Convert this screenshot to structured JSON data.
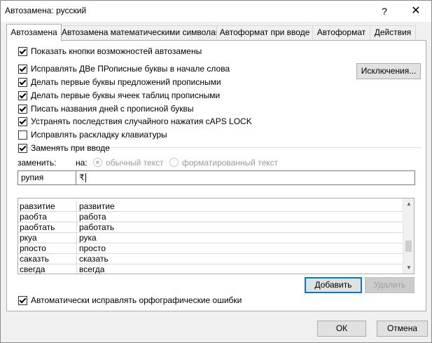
{
  "window": {
    "title": "Автозамена: русский",
    "help_label": "?",
    "close_label": "✕"
  },
  "tabs": [
    {
      "label": "Автозамена",
      "active": true
    },
    {
      "label": "Автозамена математическими символами"
    },
    {
      "label": "Автоформат при вводе"
    },
    {
      "label": "Автоформат"
    },
    {
      "label": "Действия"
    }
  ],
  "options": {
    "show_buttons": {
      "label": "Показать кнопки возможностей автозамены",
      "checked": true
    },
    "two_caps": {
      "label": "Исправлять ДВе ПРописные буквы в начале слова",
      "checked": true
    },
    "first_sentence": {
      "label": "Делать первые буквы предложений прописными",
      "checked": true
    },
    "first_cell": {
      "label": "Делать первые буквы ячеек таблиц прописными",
      "checked": true
    },
    "day_names": {
      "label": "Писать названия дней с прописной буквы",
      "checked": true
    },
    "caps_lock": {
      "label": "Устранять последствия случайного нажатия cAPS LOCK",
      "checked": true
    },
    "keyboard_layout": {
      "label": "Исправлять раскладку клавиатуры",
      "checked": false
    },
    "replace_typing": {
      "label": "Заменять при вводе",
      "checked": true
    },
    "spellcheck": {
      "label": "Автоматически исправлять орфографические ошибки",
      "checked": true
    }
  },
  "exceptions_button": "Исключения...",
  "replace": {
    "replace_label": "заменить:",
    "with_label": "на:",
    "plain_text": "обычный текст",
    "formatted_text": "форматированный текст",
    "replace_value": "рупия",
    "with_value": "₹"
  },
  "entries": [
    {
      "from": "равзитие",
      "to": "развитие"
    },
    {
      "from": "раобта",
      "to": "работа"
    },
    {
      "from": "раобтать",
      "to": "работать"
    },
    {
      "from": "ркуа",
      "to": "рука"
    },
    {
      "from": "рпосто",
      "to": "просто"
    },
    {
      "from": "саказть",
      "to": "сказать"
    },
    {
      "from": "свегда",
      "to": "всегда"
    }
  ],
  "list_buttons": {
    "add": "Добавить",
    "delete": "Удалить"
  },
  "footer": {
    "ok": "ОК",
    "cancel": "Отмена"
  },
  "colors": {
    "accent": "#0078d7"
  }
}
